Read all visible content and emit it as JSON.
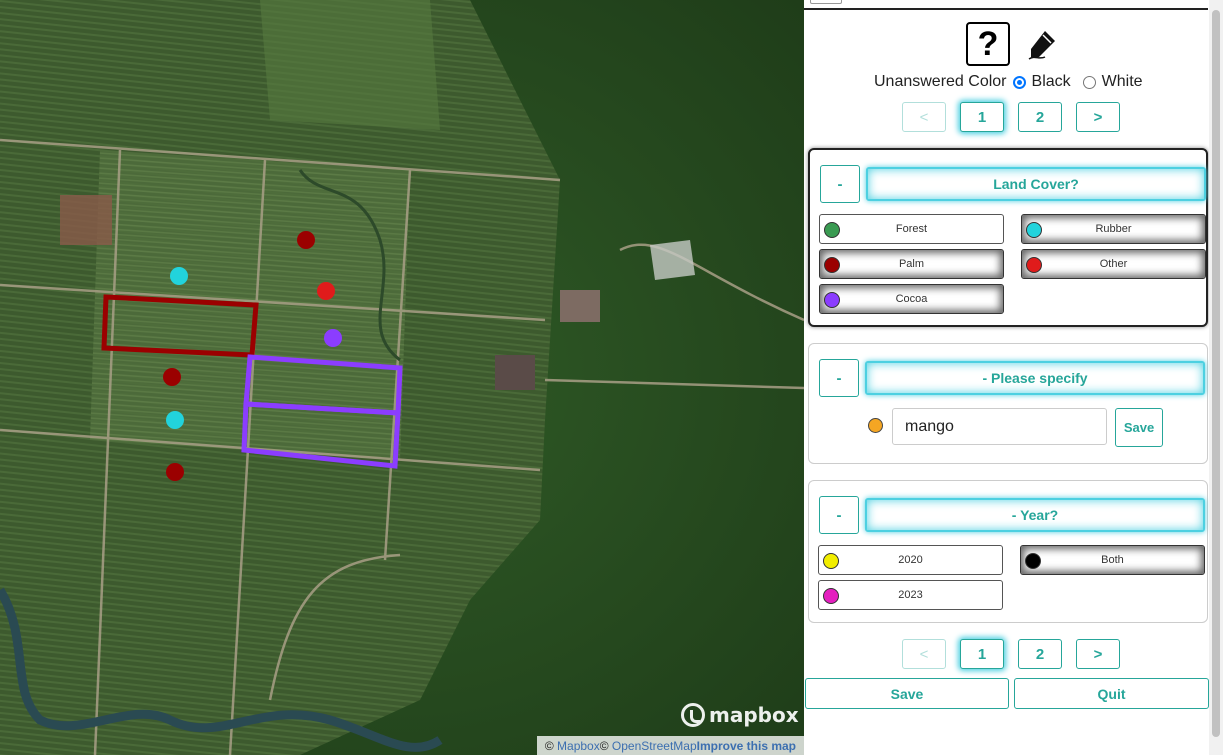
{
  "panel": {
    "unanswered_color_label": "Unanswered Color",
    "color_options": [
      "Black",
      "White"
    ],
    "selected_color": "Black",
    "pager_prev": "<",
    "pager_next": ">",
    "pages": [
      "1",
      "2"
    ],
    "current_page": "1"
  },
  "questions": [
    {
      "toggle": "-",
      "title": "Land Cover?",
      "answers": [
        {
          "label": "Forest",
          "color": "#3a9b52",
          "selected": false
        },
        {
          "label": "Rubber",
          "color": "#22d3dc",
          "selected": true
        },
        {
          "label": "Palm",
          "color": "#9b0000",
          "selected": true
        },
        {
          "label": "Other",
          "color": "#e01b1b",
          "selected": true
        },
        {
          "label": "Cocoa",
          "color": "#8b3dff",
          "selected": true
        }
      ]
    },
    {
      "toggle": "-",
      "title": "- Please specify",
      "input_value": "mango",
      "input_color": "#f5a623",
      "save_label": "Save"
    },
    {
      "toggle": "-",
      "title": "- Year?",
      "answers": [
        {
          "label": "2020",
          "color": "#f2ee00",
          "selected": false
        },
        {
          "label": "Both",
          "color": "#000000",
          "selected": true
        },
        {
          "label": "2023",
          "color": "#e41fbf",
          "selected": false
        }
      ]
    }
  ],
  "footer": {
    "save_label": "Save",
    "quit_label": "Quit"
  },
  "map": {
    "logo_text": "mapbox",
    "attribution": {
      "copy1": "©",
      "link1": "Mapbox",
      "copy2": "©",
      "link2": "OpenStreetMap",
      "improve": "Improve this map"
    },
    "sample_points": [
      {
        "color": "#9b0000"
      },
      {
        "color": "#22d3dc"
      },
      {
        "color": "#e01b1b"
      },
      {
        "color": "#8b3dff"
      },
      {
        "color": "#9b0000"
      },
      {
        "color": "#22d3dc"
      },
      {
        "color": "#9b0000"
      }
    ],
    "plots": [
      {
        "color": "#9b0000"
      },
      {
        "color": "#8b3dff"
      },
      {
        "color": "#8b3dff"
      }
    ]
  }
}
